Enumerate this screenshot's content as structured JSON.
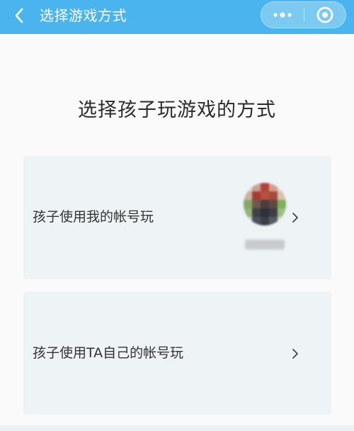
{
  "nav": {
    "title": "选择游戏方式",
    "back_icon": "chevron-left-icon",
    "more_icon": "more-dots-icon",
    "close_icon": "target-close-icon",
    "background": "#4ab4ee"
  },
  "page": {
    "title": "选择孩子玩游戏的方式"
  },
  "options": [
    {
      "label": "孩子使用我的帐号玩",
      "icon": "chevron-right-icon",
      "avatar": "blurred-avatar"
    },
    {
      "label": "孩子使用TA自己的帐号玩",
      "icon": "chevron-right-icon"
    }
  ],
  "colors": {
    "card_background": "#eef3f6",
    "page_background": "#fafafa",
    "title_text": "#2b2b2b"
  }
}
